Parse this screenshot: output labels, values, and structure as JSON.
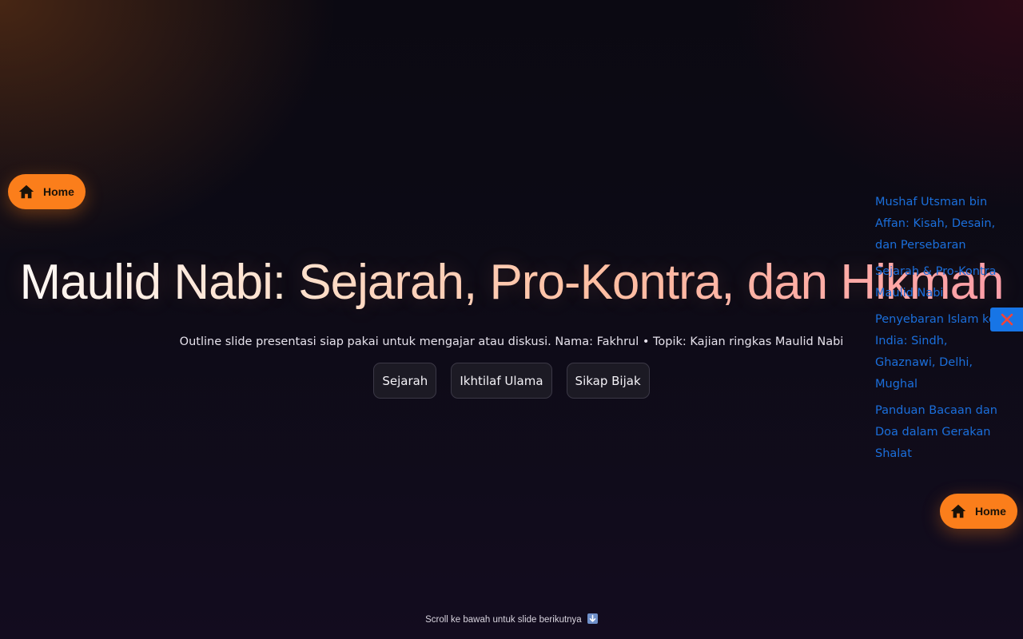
{
  "home_buttons": {
    "top": {
      "label": "Home",
      "icon": "home-icon"
    },
    "bottom": {
      "label": "Home",
      "icon": "home-icon"
    }
  },
  "hero": {
    "title": "Maulid Nabi: Sejarah, Pro-Kontra, dan Hikmah",
    "subtitle": "Outline slide presentasi siap pakai untuk mengajar atau diskusi. Nama: Fakhrul • Topik: Kajian ringkas Maulid Nabi",
    "chips": [
      {
        "label": "Sejarah"
      },
      {
        "label": "Ikhtilaf Ulama"
      },
      {
        "label": "Sikap Bijak"
      }
    ]
  },
  "side_links": [
    {
      "label": "Mushaf Utsman bin Affan: Kisah, Desain, dan Persebaran"
    },
    {
      "label": "Sejarah & Pro-Kontra Maulid Nabi"
    },
    {
      "label": "Penyebaran Islam ke India: Sindh, Ghaznawi, Delhi, Mughal"
    },
    {
      "label": "Panduan Bacaan dan Doa dalam Gerakan Shalat"
    }
  ],
  "close_button": {
    "icon": "close-icon"
  },
  "footer": {
    "scroll_hint": "Scroll ke bawah untuk slide berikutnya",
    "icon": "down-arrow-icon"
  },
  "colors": {
    "accent_orange": "#fb7e1b",
    "link_blue": "#1b6fdc",
    "close_blue": "#1775e6",
    "close_x_red": "#f0443a",
    "background": "#0d0b16"
  }
}
